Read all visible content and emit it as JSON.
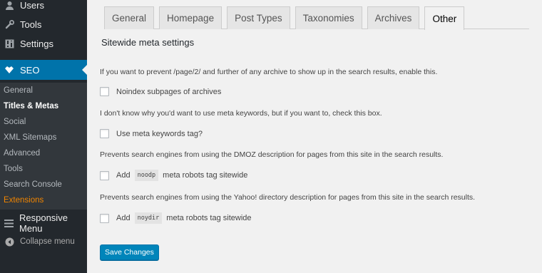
{
  "sidebar": {
    "menu": [
      {
        "label": "Users",
        "icon": "users-icon"
      },
      {
        "label": "Tools",
        "icon": "wrench-icon"
      },
      {
        "label": "Settings",
        "icon": "settings-icon"
      }
    ],
    "seo_label": "SEO",
    "seo_submenu": [
      {
        "label": "General"
      },
      {
        "label": "Titles & Metas"
      },
      {
        "label": "Social"
      },
      {
        "label": "XML Sitemaps"
      },
      {
        "label": "Advanced"
      },
      {
        "label": "Tools"
      },
      {
        "label": "Search Console"
      },
      {
        "label": "Extensions"
      }
    ],
    "responsive_menu_label": "Responsive Menu",
    "collapse_label": "Collapse menu"
  },
  "tabs": [
    "General",
    "Homepage",
    "Post Types",
    "Taxonomies",
    "Archives",
    "Other"
  ],
  "active_tab": "Other",
  "section_title": "Sitewide meta settings",
  "settings": [
    {
      "description": "If you want to prevent /page/2/ and further of any archive to show up in the search results, enable this.",
      "label": "Noindex subpages of archives",
      "checked": false
    },
    {
      "description": "I don't know why you'd want to use meta keywords, but if you want to, check this box.",
      "label": "Use meta keywords tag?",
      "checked": false
    },
    {
      "description": "Prevents search engines from using the DMOZ description for pages from this site in the search results.",
      "label_prefix": "Add",
      "code": "noodp",
      "label_suffix": "meta robots tag sitewide",
      "checked": false
    },
    {
      "description": "Prevents search engines from using the Yahoo! directory description for pages from this site in the search results.",
      "label_prefix": "Add",
      "code": "noydir",
      "label_suffix": "meta robots tag sitewide",
      "checked": false
    }
  ],
  "save_button_label": "Save Changes",
  "colors": {
    "sidebar_bg": "#23282d",
    "submenu_bg": "#32373c",
    "accent": "#0073aa",
    "extensions": "#f18500",
    "button": "#0085ba"
  }
}
